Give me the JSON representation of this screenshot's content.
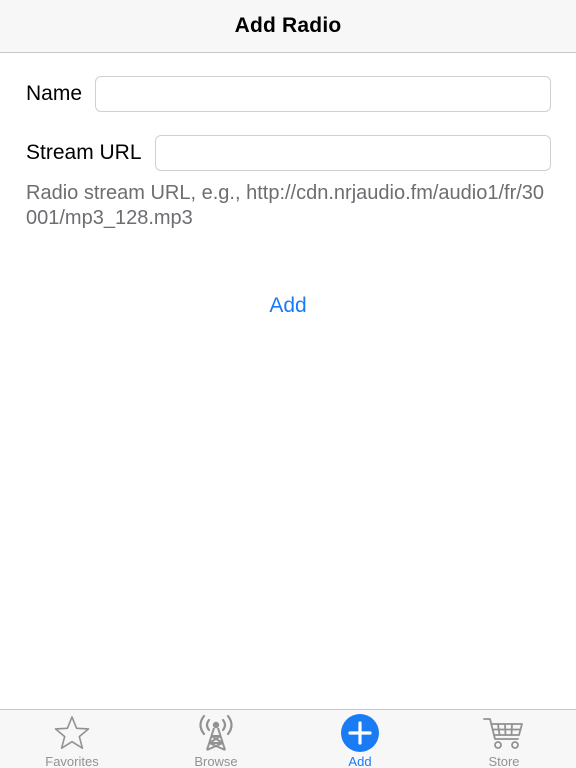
{
  "nav": {
    "title": "Add Radio"
  },
  "form": {
    "name_label": "Name",
    "name_value": "",
    "stream_label": "Stream URL",
    "stream_value": "",
    "hint": "Radio stream URL, e.g., http://cdn.nrjaudio.fm/audio1/fr/30001/mp3_128.mp3",
    "add_label": "Add"
  },
  "tabs": [
    {
      "label": "Favorites",
      "icon": "star-icon",
      "active": false
    },
    {
      "label": "Browse",
      "icon": "radio-tower-icon",
      "active": false
    },
    {
      "label": "Add",
      "icon": "plus-circle-icon",
      "active": true
    },
    {
      "label": "Store",
      "icon": "cart-icon",
      "active": false
    }
  ],
  "colors": {
    "accent": "#1a7cf5",
    "inactive": "#929292",
    "bar_bg": "#f7f7f7"
  }
}
